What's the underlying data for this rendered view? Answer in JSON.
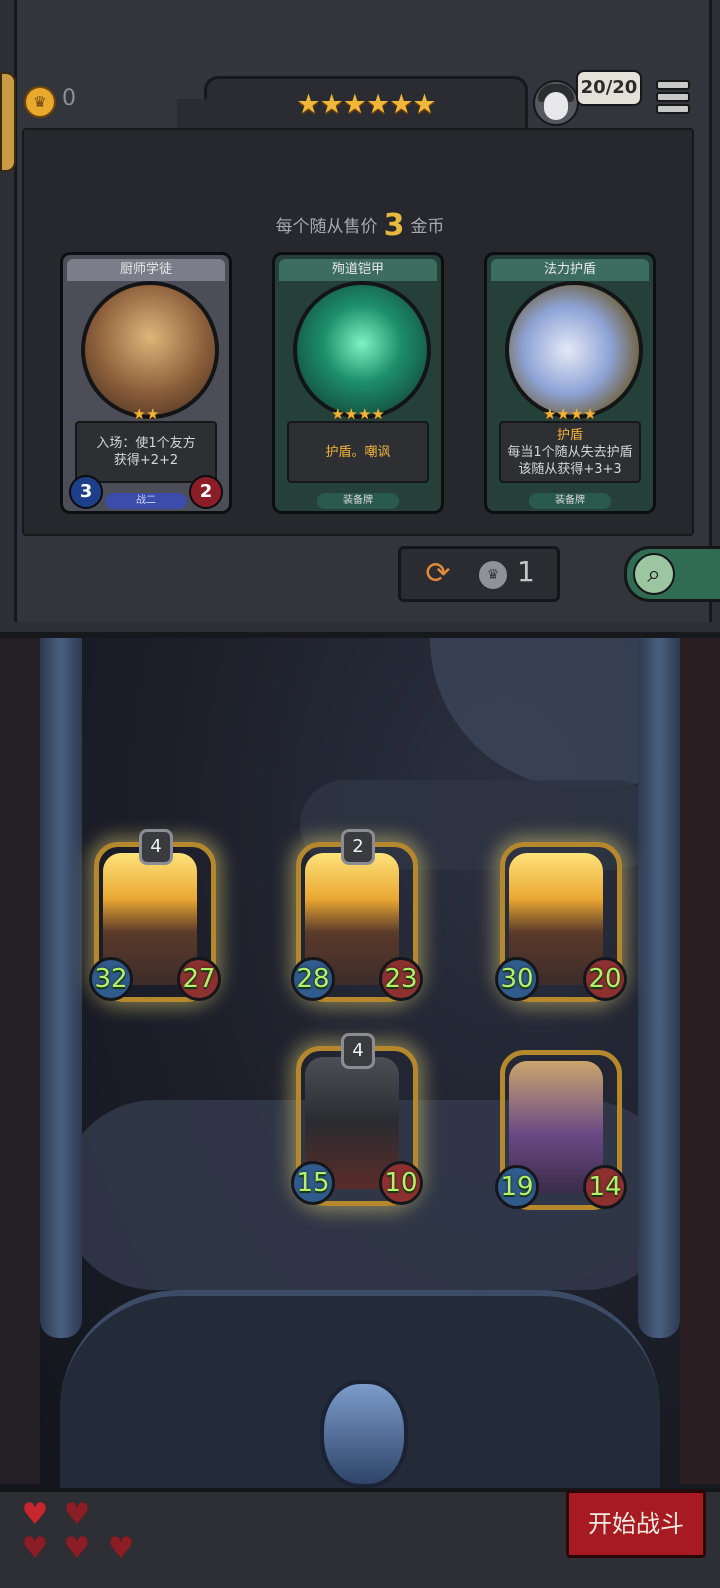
{
  "header": {
    "gold": "0",
    "tier_stars": "★★★★★★",
    "turns": "20/20"
  },
  "shop": {
    "sell_prefix": "每个随从售价",
    "sell_price": "3",
    "sell_suffix": "金币",
    "cards": [
      {
        "title": "厨师学徒",
        "stars": "★★",
        "desc_line1": "入场：使1个友方",
        "desc_line2": "获得+2+2",
        "tag": "战二",
        "attack": "3",
        "health": "2"
      },
      {
        "title": "殉道铠甲",
        "stars": "★★★★",
        "desc_line1": "护盾。嘲讽",
        "desc_line2": "",
        "tag": "装备牌"
      },
      {
        "title": "法力护盾",
        "stars": "★★★★",
        "desc_line1": "护盾",
        "desc_line2": "每当1个随从失去护盾",
        "desc_line3": "该随从获得+3+3",
        "tag": "装备牌"
      }
    ],
    "refresh_cost": "1"
  },
  "board": {
    "units": [
      {
        "level": "4",
        "attack": "32",
        "health": "27"
      },
      {
        "level": "2",
        "attack": "28",
        "health": "23"
      },
      {
        "level": "",
        "attack": "30",
        "health": "20"
      },
      {
        "level": "4",
        "attack": "15",
        "health": "10"
      },
      {
        "level": "",
        "attack": "19",
        "health": "14"
      }
    ]
  },
  "footer": {
    "start_label": "开始战斗",
    "hearts_total": 5
  },
  "colors": {
    "gold": "#e9a92c",
    "start_button": "#a81a21",
    "stat_text": "#b4f06a"
  }
}
